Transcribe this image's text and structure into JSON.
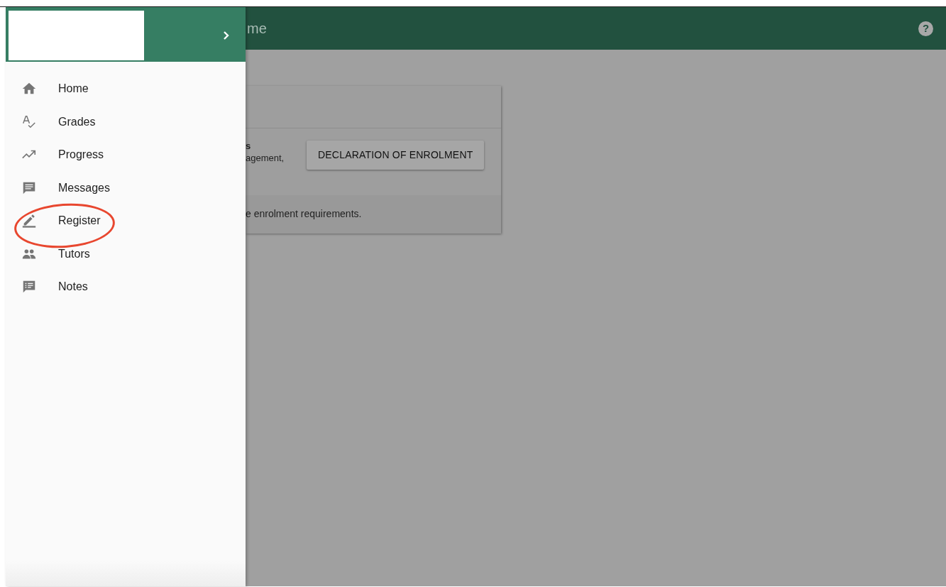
{
  "top_bar": {
    "title": "me",
    "help": "?"
  },
  "drawer": {
    "items": [
      {
        "label": "Home",
        "circled": false
      },
      {
        "label": "Grades",
        "circled": false
      },
      {
        "label": "Progress",
        "circled": false
      },
      {
        "label": "Messages",
        "circled": false
      },
      {
        "label": "Register",
        "circled": true
      },
      {
        "label": "Tutors",
        "circled": false
      },
      {
        "label": "Notes",
        "circled": false
      }
    ]
  },
  "card": {
    "heading_line": "s",
    "body_line": "agement,",
    "button": "DECLARATION OF ENROLMENT",
    "footer": "e enrolment requirements."
  }
}
